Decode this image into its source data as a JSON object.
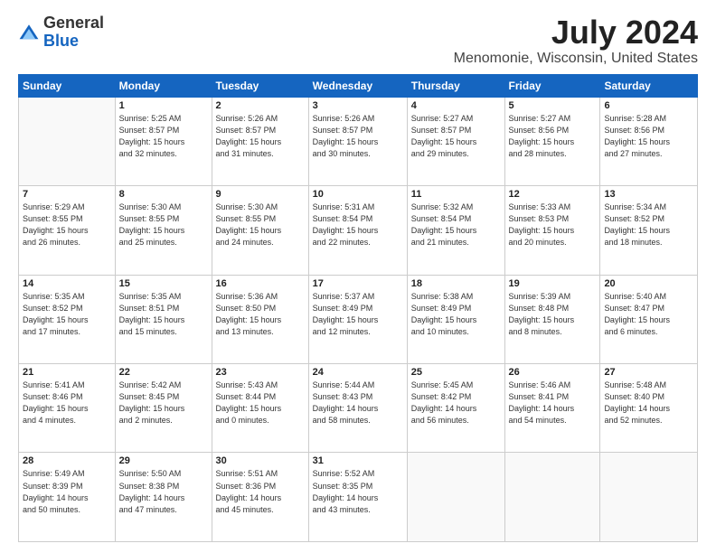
{
  "header": {
    "logo_line1": "General",
    "logo_line2": "Blue",
    "month": "July 2024",
    "location": "Menomonie, Wisconsin, United States"
  },
  "weekdays": [
    "Sunday",
    "Monday",
    "Tuesday",
    "Wednesday",
    "Thursday",
    "Friday",
    "Saturday"
  ],
  "weeks": [
    [
      {
        "day": "",
        "info": ""
      },
      {
        "day": "1",
        "info": "Sunrise: 5:25 AM\nSunset: 8:57 PM\nDaylight: 15 hours\nand 32 minutes."
      },
      {
        "day": "2",
        "info": "Sunrise: 5:26 AM\nSunset: 8:57 PM\nDaylight: 15 hours\nand 31 minutes."
      },
      {
        "day": "3",
        "info": "Sunrise: 5:26 AM\nSunset: 8:57 PM\nDaylight: 15 hours\nand 30 minutes."
      },
      {
        "day": "4",
        "info": "Sunrise: 5:27 AM\nSunset: 8:57 PM\nDaylight: 15 hours\nand 29 minutes."
      },
      {
        "day": "5",
        "info": "Sunrise: 5:27 AM\nSunset: 8:56 PM\nDaylight: 15 hours\nand 28 minutes."
      },
      {
        "day": "6",
        "info": "Sunrise: 5:28 AM\nSunset: 8:56 PM\nDaylight: 15 hours\nand 27 minutes."
      }
    ],
    [
      {
        "day": "7",
        "info": "Sunrise: 5:29 AM\nSunset: 8:55 PM\nDaylight: 15 hours\nand 26 minutes."
      },
      {
        "day": "8",
        "info": "Sunrise: 5:30 AM\nSunset: 8:55 PM\nDaylight: 15 hours\nand 25 minutes."
      },
      {
        "day": "9",
        "info": "Sunrise: 5:30 AM\nSunset: 8:55 PM\nDaylight: 15 hours\nand 24 minutes."
      },
      {
        "day": "10",
        "info": "Sunrise: 5:31 AM\nSunset: 8:54 PM\nDaylight: 15 hours\nand 22 minutes."
      },
      {
        "day": "11",
        "info": "Sunrise: 5:32 AM\nSunset: 8:54 PM\nDaylight: 15 hours\nand 21 minutes."
      },
      {
        "day": "12",
        "info": "Sunrise: 5:33 AM\nSunset: 8:53 PM\nDaylight: 15 hours\nand 20 minutes."
      },
      {
        "day": "13",
        "info": "Sunrise: 5:34 AM\nSunset: 8:52 PM\nDaylight: 15 hours\nand 18 minutes."
      }
    ],
    [
      {
        "day": "14",
        "info": "Sunrise: 5:35 AM\nSunset: 8:52 PM\nDaylight: 15 hours\nand 17 minutes."
      },
      {
        "day": "15",
        "info": "Sunrise: 5:35 AM\nSunset: 8:51 PM\nDaylight: 15 hours\nand 15 minutes."
      },
      {
        "day": "16",
        "info": "Sunrise: 5:36 AM\nSunset: 8:50 PM\nDaylight: 15 hours\nand 13 minutes."
      },
      {
        "day": "17",
        "info": "Sunrise: 5:37 AM\nSunset: 8:49 PM\nDaylight: 15 hours\nand 12 minutes."
      },
      {
        "day": "18",
        "info": "Sunrise: 5:38 AM\nSunset: 8:49 PM\nDaylight: 15 hours\nand 10 minutes."
      },
      {
        "day": "19",
        "info": "Sunrise: 5:39 AM\nSunset: 8:48 PM\nDaylight: 15 hours\nand 8 minutes."
      },
      {
        "day": "20",
        "info": "Sunrise: 5:40 AM\nSunset: 8:47 PM\nDaylight: 15 hours\nand 6 minutes."
      }
    ],
    [
      {
        "day": "21",
        "info": "Sunrise: 5:41 AM\nSunset: 8:46 PM\nDaylight: 15 hours\nand 4 minutes."
      },
      {
        "day": "22",
        "info": "Sunrise: 5:42 AM\nSunset: 8:45 PM\nDaylight: 15 hours\nand 2 minutes."
      },
      {
        "day": "23",
        "info": "Sunrise: 5:43 AM\nSunset: 8:44 PM\nDaylight: 15 hours\nand 0 minutes."
      },
      {
        "day": "24",
        "info": "Sunrise: 5:44 AM\nSunset: 8:43 PM\nDaylight: 14 hours\nand 58 minutes."
      },
      {
        "day": "25",
        "info": "Sunrise: 5:45 AM\nSunset: 8:42 PM\nDaylight: 14 hours\nand 56 minutes."
      },
      {
        "day": "26",
        "info": "Sunrise: 5:46 AM\nSunset: 8:41 PM\nDaylight: 14 hours\nand 54 minutes."
      },
      {
        "day": "27",
        "info": "Sunrise: 5:48 AM\nSunset: 8:40 PM\nDaylight: 14 hours\nand 52 minutes."
      }
    ],
    [
      {
        "day": "28",
        "info": "Sunrise: 5:49 AM\nSunset: 8:39 PM\nDaylight: 14 hours\nand 50 minutes."
      },
      {
        "day": "29",
        "info": "Sunrise: 5:50 AM\nSunset: 8:38 PM\nDaylight: 14 hours\nand 47 minutes."
      },
      {
        "day": "30",
        "info": "Sunrise: 5:51 AM\nSunset: 8:36 PM\nDaylight: 14 hours\nand 45 minutes."
      },
      {
        "day": "31",
        "info": "Sunrise: 5:52 AM\nSunset: 8:35 PM\nDaylight: 14 hours\nand 43 minutes."
      },
      {
        "day": "",
        "info": ""
      },
      {
        "day": "",
        "info": ""
      },
      {
        "day": "",
        "info": ""
      }
    ]
  ]
}
